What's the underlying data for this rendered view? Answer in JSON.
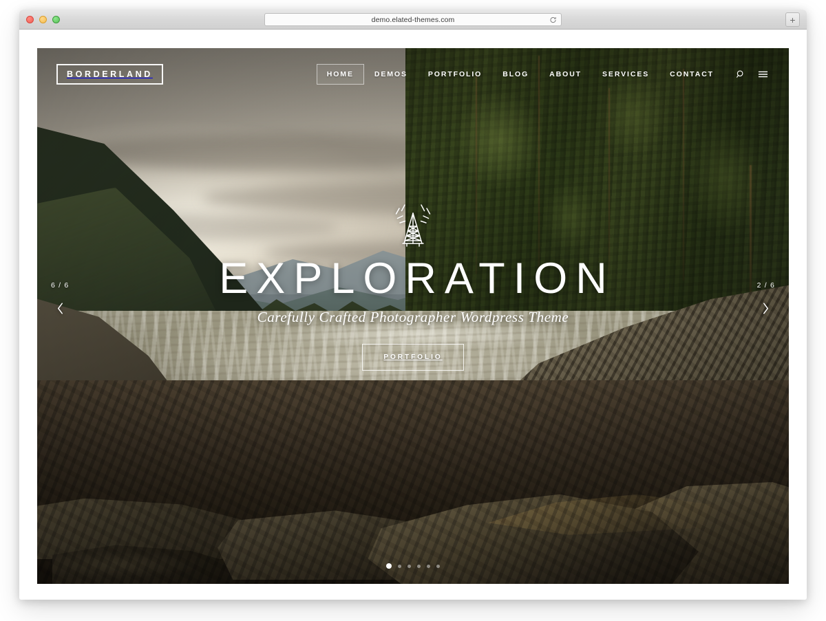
{
  "browser": {
    "url": "demo.elated-themes.com",
    "reload_icon": "reload-icon",
    "new_tab_label": "+",
    "traffic_lights": [
      "close",
      "minimize",
      "maximize"
    ]
  },
  "site": {
    "logo": {
      "text": "BORDERLAND"
    },
    "nav": {
      "items": [
        {
          "label": "HOME",
          "active": true
        },
        {
          "label": "DEMOS",
          "active": false
        },
        {
          "label": "PORTFOLIO",
          "active": false
        },
        {
          "label": "BLOG",
          "active": false
        },
        {
          "label": "ABOUT",
          "active": false
        },
        {
          "label": "SERVICES",
          "active": false
        },
        {
          "label": "CONTACT",
          "active": false
        }
      ],
      "icons": [
        {
          "name": "search-icon"
        },
        {
          "name": "hamburger-menu-icon"
        }
      ]
    },
    "slider": {
      "icon_name": "radio-tower-icon",
      "title": "EXPLORATION",
      "subtitle": "Carefully Crafted Photographer Wordpress Theme",
      "button_label": "PORTFOLIO",
      "left_counter": "6 / 6",
      "right_counter": "2 / 6",
      "prev_icon": "chevron-left-icon",
      "next_icon": "chevron-right-icon",
      "dots_total": 6,
      "dots_active_index": 0
    }
  },
  "colors": {
    "accent_white": "#ffffff",
    "sky_top": "#9a958b",
    "sky_bottom": "#d9d2c1",
    "forest_green": "#4a5b28",
    "rock_brown": "#4b4433",
    "river_tone": "#8d8972"
  }
}
